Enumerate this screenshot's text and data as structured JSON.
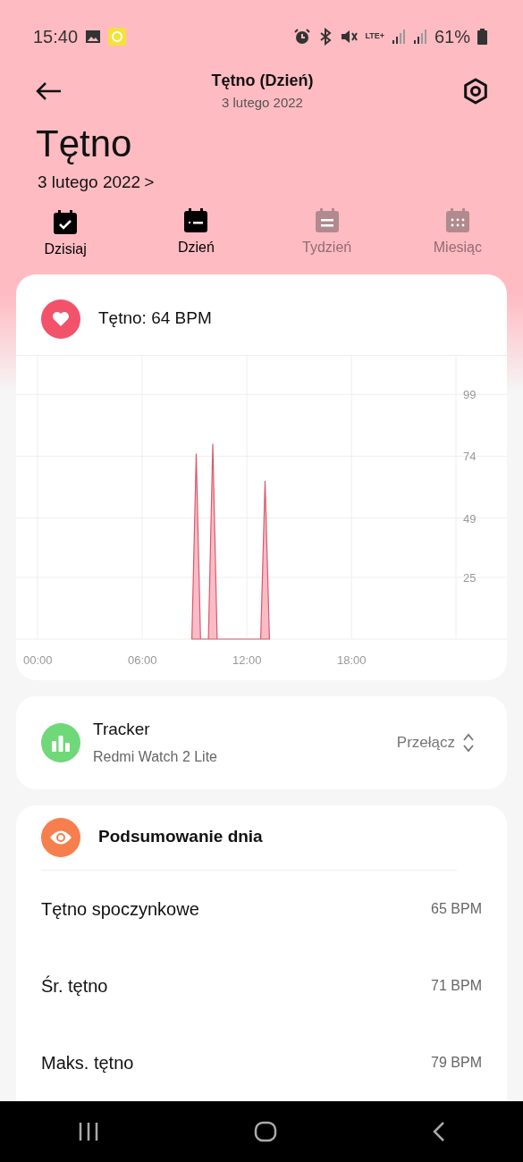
{
  "status_bar": {
    "time": "15:40",
    "battery": "61%",
    "network": "LTE+"
  },
  "header": {
    "title": "Tętno (Dzień)",
    "subtitle": "3 lutego 2022"
  },
  "page": {
    "title": "Tętno",
    "date": "3 lutego 2022",
    "chevron": ">"
  },
  "today_button": {
    "label": "Dzisiaj"
  },
  "tabs": [
    {
      "label": "Dzień",
      "selected": true
    },
    {
      "label": "Tydzień",
      "selected": false
    },
    {
      "label": "Miesiąc",
      "selected": false
    }
  ],
  "heart_card": {
    "reading": "Tętno: 64 BPM",
    "chart_data": {
      "type": "area",
      "x": [
        8.85,
        9.1,
        9.35,
        9.8,
        10.05,
        10.3,
        12.8,
        13.05,
        13.3
      ],
      "series": [
        {
          "color": "#d9596c",
          "values": [
            0,
            75,
            0,
            0,
            79,
            0,
            0,
            64,
            0
          ]
        }
      ],
      "xlim": [
        -1.23,
        26.92
      ],
      "ylim": [
        0,
        115
      ],
      "grid": true,
      "xticks": [
        {
          "value": 0,
          "label": "00:00"
        },
        {
          "value": 6,
          "label": "06:00"
        },
        {
          "value": 12,
          "label": "12:00"
        },
        {
          "value": 18,
          "label": "18:00"
        }
      ],
      "yticks": [
        25,
        49,
        74,
        99
      ]
    }
  },
  "device_card": {
    "title": "Tracker",
    "device": "Redmi Watch 2 Lite",
    "switch_label": "Przełącz"
  },
  "summary": {
    "title": "Podsumowanie dnia",
    "rows": [
      {
        "label": "Tętno spoczynkowe",
        "value": "65 BPM"
      },
      {
        "label": "Śr. tętno",
        "value": "71 BPM"
      },
      {
        "label": "Maks. tętno",
        "value": "79 BPM"
      }
    ]
  }
}
